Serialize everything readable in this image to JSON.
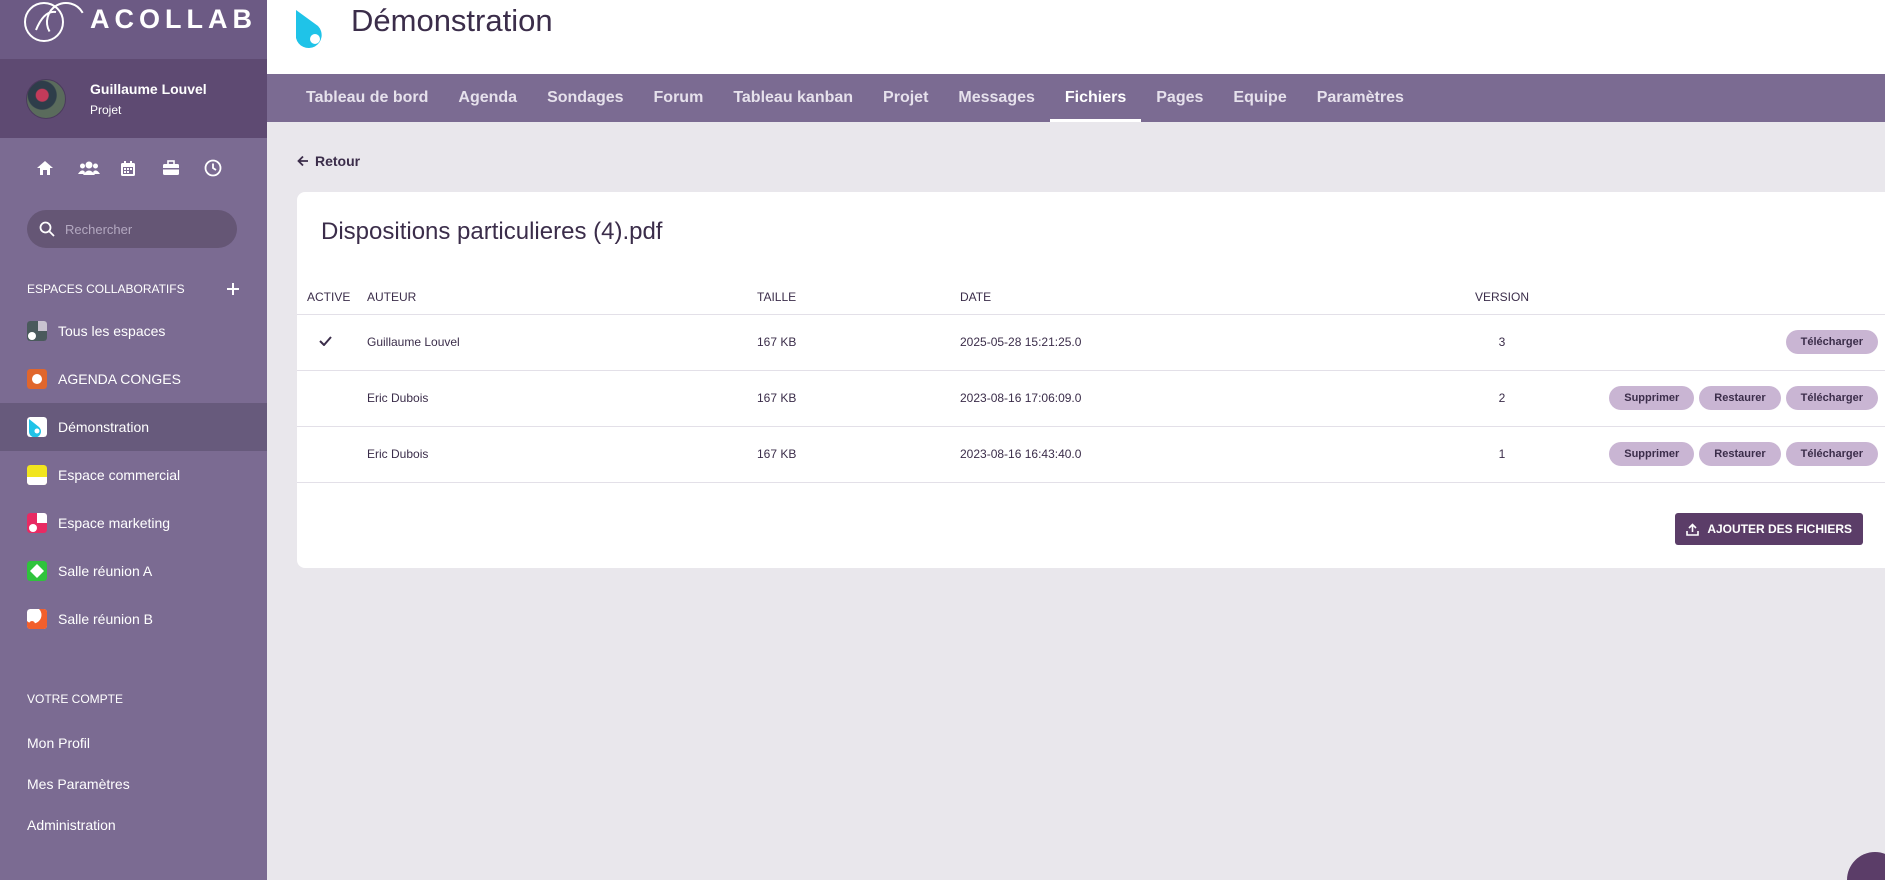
{
  "brand": {
    "name": "ACOLLAB"
  },
  "user": {
    "name": "Guillaume Louvel",
    "role": "Projet"
  },
  "quick_icons": [
    "home-icon",
    "people-icon",
    "calendar-icon",
    "briefcase-icon",
    "clock-icon"
  ],
  "search": {
    "placeholder": "Rechercher"
  },
  "spaces": {
    "title": "ESPACES COLLABORATIFS",
    "items": [
      {
        "label": "Tous les espaces",
        "color": "#4a5a5c"
      },
      {
        "label": "AGENDA CONGES",
        "color": "#e0662c"
      },
      {
        "label": "Démonstration",
        "color": "#1fc3e8"
      },
      {
        "label": "Espace commercial",
        "color": "#f1e51e"
      },
      {
        "label": "Espace marketing",
        "color": "#e82a63"
      },
      {
        "label": "Salle réunion A",
        "color": "#2fc33c"
      },
      {
        "label": "Salle réunion B",
        "color": "#f25f2c"
      }
    ]
  },
  "account": {
    "title": "VOTRE COMPTE",
    "links": [
      "Mon Profil",
      "Mes Paramètres",
      "Administration"
    ]
  },
  "header": {
    "title": "Démonstration"
  },
  "tabs": [
    "Tableau de bord",
    "Agenda",
    "Sondages",
    "Forum",
    "Tableau kanban",
    "Projet",
    "Messages",
    "Fichiers",
    "Pages",
    "Equipe",
    "Paramètres"
  ],
  "active_tab": "Fichiers",
  "back_label": "Retour",
  "file": {
    "title": "Dispositions particulieres (4).pdf"
  },
  "table": {
    "headers": {
      "active": "ACTIVE",
      "author": "AUTEUR",
      "size": "TAILLE",
      "date": "DATE",
      "version": "VERSION"
    },
    "rows": [
      {
        "active": true,
        "author": "Guillaume Louvel",
        "size": "167 KB",
        "date": "2025-05-28 15:21:25.0",
        "version": "3"
      },
      {
        "active": false,
        "author": "Eric Dubois",
        "size": "167 KB",
        "date": "2023-08-16 17:06:09.0",
        "version": "2"
      },
      {
        "active": false,
        "author": "Eric Dubois",
        "size": "167 KB",
        "date": "2023-08-16 16:43:40.0",
        "version": "1"
      }
    ],
    "actions": {
      "delete": "Supprimer",
      "restore": "Restaurer",
      "download": "Télécharger"
    }
  },
  "add_files_label": "AJOUTER DES FICHIERS"
}
